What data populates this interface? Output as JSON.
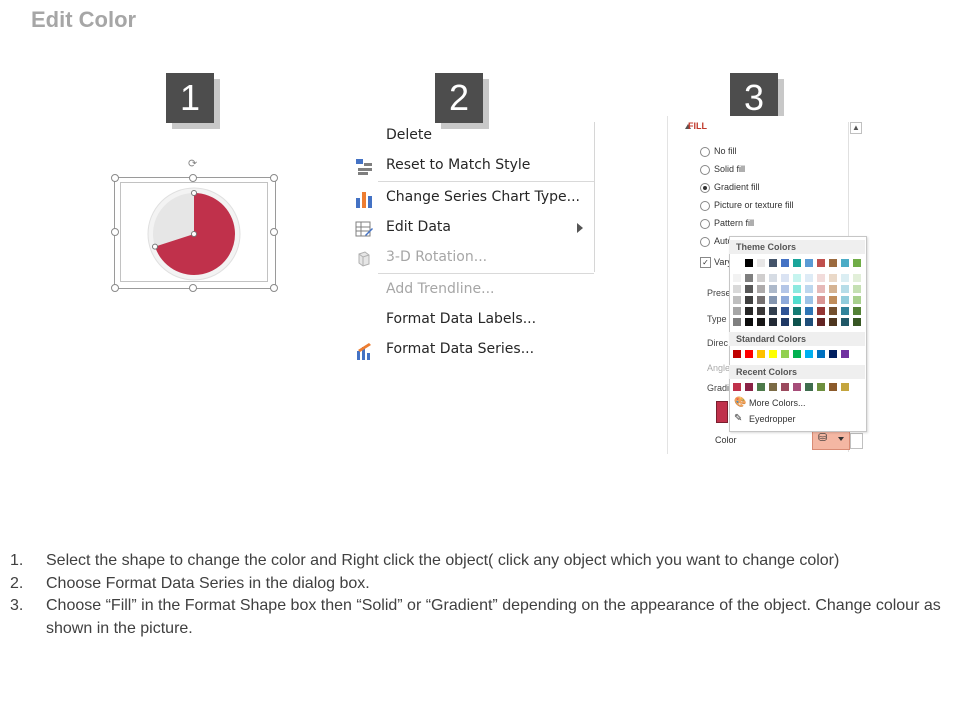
{
  "title": "Edit Color",
  "steps": [
    "1",
    "2",
    "3"
  ],
  "pie": {
    "colors": {
      "main": "#c0314b",
      "rest": "#e6e6e6"
    },
    "values": [
      0.7,
      0.3
    ]
  },
  "context_menu": {
    "items": [
      {
        "label": "Delete",
        "icon": ""
      },
      {
        "label": "Reset to Match Style",
        "icon": "reset-style-icon"
      },
      {
        "label": "Change Series Chart Type...",
        "icon": "bar-chart-icon"
      },
      {
        "label": "Edit Data",
        "icon": "edit-data-icon"
      },
      {
        "label": "3-D Rotation...",
        "icon": "cube-icon"
      },
      {
        "label": "Add Trendline...",
        "icon": ""
      },
      {
        "label": "Format Data Labels...",
        "icon": ""
      },
      {
        "label": "Format Data Series...",
        "icon": "format-series-icon"
      }
    ]
  },
  "format_pane": {
    "section": "FILL",
    "options": [
      "No fill",
      "Solid fill",
      "Gradient fill",
      "Picture or texture fill",
      "Pattern fill",
      "Auto"
    ],
    "selected": "Gradient fill",
    "checkbox_label": "Vary",
    "side_labels": [
      "Prese",
      "Type",
      "Direc",
      "Angle",
      "Gradi"
    ],
    "color_label": "Color"
  },
  "palette": {
    "theme_header": "Theme Colors",
    "standard_header": "Standard Colors",
    "recent_header": "Recent Colors",
    "more_colors": "More Colors...",
    "eyedropper": "Eyedropper",
    "theme_top": [
      "#ffffff",
      "#000000",
      "#e7e6e6",
      "#44546a",
      "#4472c4",
      "#1aa59a",
      "#5b9bd5",
      "#c0504d",
      "#9c6b3f",
      "#4bacc6",
      "#70ad47"
    ],
    "theme_tints": [
      [
        "#f2f2f2",
        "#7f7f7f",
        "#d0cece",
        "#d6dce4",
        "#dae3f3",
        "#c6f4ef",
        "#deebf6",
        "#f2dcdb",
        "#ead9c8",
        "#dbeef3",
        "#e2efd9"
      ],
      [
        "#d9d9d9",
        "#595959",
        "#aeabab",
        "#adb9ca",
        "#b4c6e7",
        "#8ce9df",
        "#bdd7ee",
        "#e6b9b8",
        "#d5b392",
        "#b7dde8",
        "#c5e0b3"
      ],
      [
        "#bfbfbf",
        "#3f3f3f",
        "#757070",
        "#8496b0",
        "#8eaadb",
        "#53ddce",
        "#9dc3e6",
        "#d99694",
        "#c08d5b",
        "#92cddc",
        "#a8d08d"
      ],
      [
        "#a6a6a6",
        "#262626",
        "#3a3838",
        "#323f4f",
        "#2f5496",
        "#137b73",
        "#2e75b5",
        "#943634",
        "#74502e",
        "#31849b",
        "#538135"
      ],
      [
        "#7f7f7f",
        "#0c0c0c",
        "#171616",
        "#222a35",
        "#1f3864",
        "#0d524d",
        "#1f4e79",
        "#632423",
        "#4e361f",
        "#205867",
        "#375623"
      ]
    ],
    "standard": [
      "#c00000",
      "#ff0000",
      "#ffc000",
      "#ffff00",
      "#92d050",
      "#00b050",
      "#00b0f0",
      "#0070c0",
      "#002060",
      "#7030a0"
    ],
    "recent": [
      "#c0314b",
      "#8b2346",
      "#4d7a4a",
      "#7b6b45",
      "#9b4a5e",
      "#a64d79",
      "#3f6d4e",
      "#6d8f3e",
      "#8b5a2b",
      "#c4a53e"
    ]
  },
  "instructions": [
    {
      "num": "1.",
      "text": "Select the shape to change the color and Right click the object( click any object which you want to change color)"
    },
    {
      "num": "2.",
      "text": "Choose Format Data Series in the dialog box."
    },
    {
      "num": "3.",
      "text": "Choose “Fill” in the Format Shape box then “Solid” or “Gradient” depending on the appearance of the object. Change colour as shown in the picture."
    }
  ]
}
